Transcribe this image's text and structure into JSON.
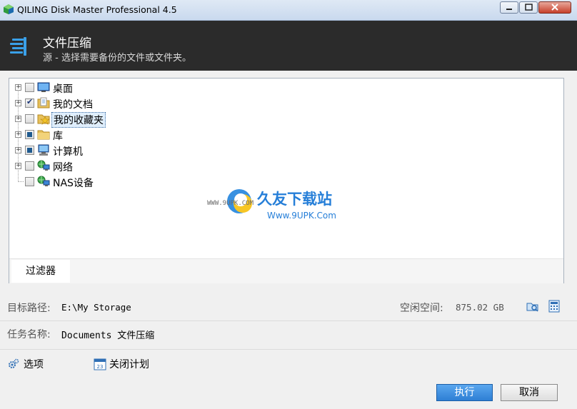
{
  "window": {
    "title": "QILING Disk Master Professional 4.5"
  },
  "header": {
    "title": "文件压缩",
    "subtitle": "源 - 选择需要备份的文件或文件夹。"
  },
  "tree": {
    "items": [
      {
        "label": "桌面",
        "state": "unchecked",
        "icon": "desktop-icon"
      },
      {
        "label": "我的文档",
        "state": "checked",
        "icon": "documents-folder-icon"
      },
      {
        "label": "我的收藏夹",
        "state": "unchecked",
        "icon": "favorites-folder-icon",
        "selected": true
      },
      {
        "label": "库",
        "state": "partial",
        "icon": "library-folder-icon"
      },
      {
        "label": "计算机",
        "state": "partial",
        "icon": "computer-icon"
      },
      {
        "label": "网络",
        "state": "unchecked",
        "icon": "network-icon"
      },
      {
        "label": "NAS设备",
        "state": "unchecked",
        "icon": "nas-icon"
      }
    ],
    "filter_tab": "过滤器"
  },
  "watermark": {
    "brand": "久友下载站",
    "url_left": "WWW.9UPK.COM",
    "url_right": "Www.9UPK.Com"
  },
  "destination": {
    "label": "目标路径:",
    "path": "E:\\My Storage",
    "free_label": "空闲空间:",
    "free_value": "875.02 GB"
  },
  "task": {
    "label": "任务名称:",
    "value": "Documents 文件压缩"
  },
  "options": {
    "options_label": "选项",
    "schedule_label": "关闭计划"
  },
  "buttons": {
    "execute": "执行",
    "cancel": "取消"
  },
  "colors": {
    "header_bg": "#2b2b2b",
    "primary_button": "#2e7fd4",
    "selection": "#dfeefc"
  }
}
